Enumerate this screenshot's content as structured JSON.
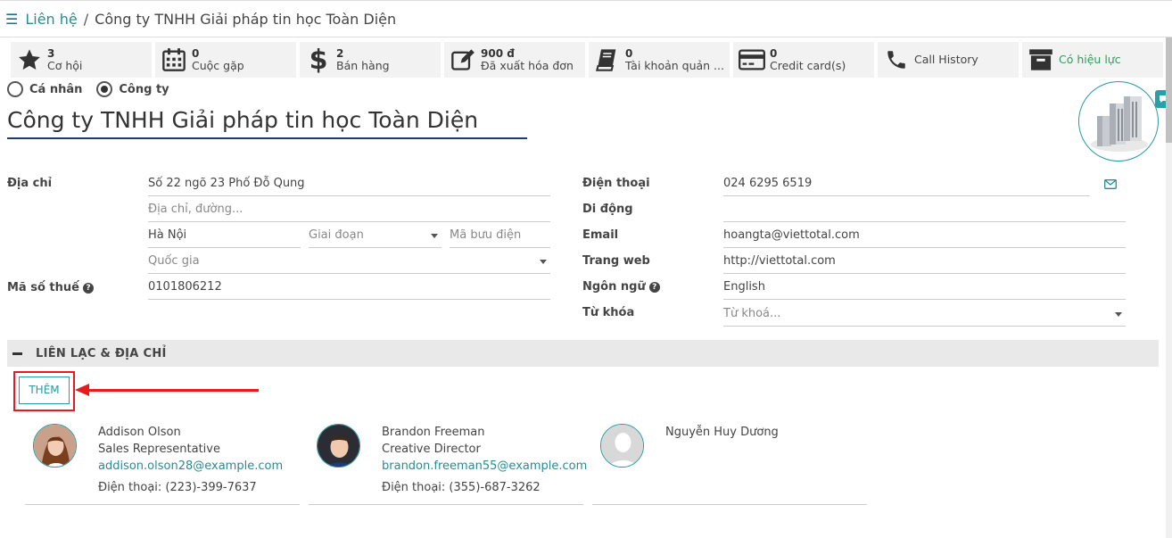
{
  "breadcrumb": {
    "parent": "Liên hệ",
    "separator": "/",
    "current": "Công ty TNHH Giải pháp tin học Toàn Diện"
  },
  "smart_buttons": [
    {
      "number": "3",
      "label": "Cơ hội",
      "icon": "star-icon"
    },
    {
      "number": "0",
      "label": "Cuộc gặp",
      "icon": "calendar-icon"
    },
    {
      "number": "2",
      "label": "Bán hàng",
      "icon": "dollar-icon"
    },
    {
      "number": "900 đ",
      "label": "Đã xuất hóa đơn",
      "icon": "edit-invoice-icon"
    },
    {
      "number": "0",
      "label": "Tài khoản quản ...",
      "icon": "book-icon"
    },
    {
      "number": "0",
      "label": "Credit card(s)",
      "icon": "credit-card-icon"
    },
    {
      "number": "",
      "label": "Call History",
      "icon": "phone-icon"
    },
    {
      "number": "",
      "label": "Có hiệu lực",
      "icon": "archive-icon"
    }
  ],
  "type_options": {
    "individual": "Cá nhân",
    "company": "Công ty",
    "selected": "company"
  },
  "company_name": "Công ty TNHH Giải pháp tin học Toàn Diện",
  "left_fields": {
    "address_label": "Địa chỉ",
    "street": "Số 22 ngõ 23 Phố Đỗ Qung",
    "street2_placeholder": "Địa chỉ, đường...",
    "city": "Hà Nội",
    "state_placeholder": "Giai đoạn",
    "zip_placeholder": "Mã bưu điện",
    "country_placeholder": "Quốc gia",
    "vat_label": "Mã số thuế",
    "vat": "0101806212"
  },
  "right_fields": {
    "phone_label": "Điện thoại",
    "phone": "024 6295 6519",
    "mobile_label": "Di động",
    "mobile": "",
    "email_label": "Email",
    "email": "hoangta@viettotal.com",
    "website_label": "Trang web",
    "website": "http://viettotal.com",
    "language_label": "Ngôn ngữ",
    "language": "English",
    "tags_label": "Từ khóa",
    "tags_placeholder": "Từ khoá..."
  },
  "section_title": "LIÊN LẠC & ĐỊA CHỈ",
  "add_button": "THÊM",
  "contacts": [
    {
      "name": "Addison Olson",
      "title": "Sales Representative",
      "email": "addison.olson28@example.com",
      "phone": "Điện thoại: (223)-399-7637"
    },
    {
      "name": "Brandon Freeman",
      "title": "Creative Director",
      "email": "brandon.freeman55@example.com",
      "phone": "Điện thoại: (355)-687-3262"
    },
    {
      "name": "Nguyễn Huy Dương",
      "title": "",
      "email": "",
      "phone": ""
    }
  ],
  "colors": {
    "teal": "#2a9aa3",
    "highlight_red": "#e8191f",
    "active_green": "#2e9d5a",
    "name_underline": "#1d3f6e"
  }
}
